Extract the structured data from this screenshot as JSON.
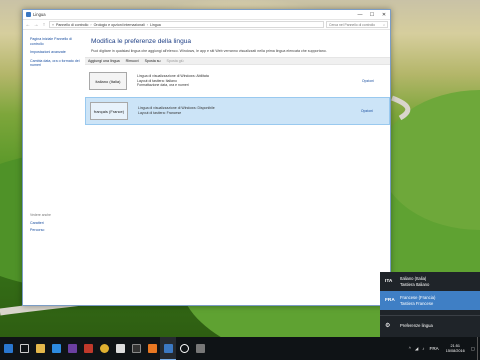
{
  "window": {
    "title": "Lingua",
    "minimize": "—",
    "maximize": "☐",
    "close": "✕",
    "back": "←",
    "forward": "→",
    "up": "↑",
    "breadcrumb": [
      "Pannello di controllo",
      "Orologio e opzioni internazionali",
      "Lingua"
    ],
    "search_placeholder": "Cerca nel Pannello di controllo",
    "search_icon": "⌕"
  },
  "leftnav": {
    "links": [
      "Pagina iniziale Pannello di controllo",
      "Impostazioni avanzate",
      "Cambia data, ora o formato dei numeri"
    ],
    "see_also": "Vedere anche",
    "bottom_links": [
      "Caratteri",
      "Percorso"
    ]
  },
  "main": {
    "heading": "Modifica le preferenze della lingua",
    "description": "Puoi digitare in qualsiasi lingua che aggiungi all'elenco. Windows, le app e siti Web verranno visualizzati nella prima lingua elencata che supportano.",
    "toolbar": [
      "Aggiungi una lingua",
      "Rimuovi",
      "Sposta su",
      "Sposta giù"
    ],
    "languages": [
      {
        "name": "italiano (Italia)",
        "lines": [
          "Lingua di visualizzazione di Windows: Abilitata",
          "Layout di tastiera: Italiano",
          "Formattazione data, ora e numeri"
        ],
        "options": "Opzioni"
      },
      {
        "name": "français (France)",
        "lines": [
          "Lingua di visualizzazione di Windows: Disponibile",
          "Layout di tastiera: Francese"
        ],
        "options": "Opzioni"
      }
    ]
  },
  "flyout": {
    "items": [
      {
        "code": "ITA",
        "line1": "Italiano (Italia)",
        "line2": "Tastiera Italiano"
      },
      {
        "code": "FRA",
        "line1": "Francese (Francia)",
        "line2": "Tastiera Francese"
      }
    ],
    "preferences": "Preferenze lingua",
    "gear_icon": "⚙"
  },
  "taskbar": {
    "lang": "FRA",
    "time": "21:51",
    "date": "15/08/2016",
    "tray_up": "^",
    "notify": "▢"
  },
  "colors": {
    "selection": "#cce4f7",
    "flyout_bg": "#1f2429",
    "flyout_selected": "#3f7fc5",
    "link": "#1a4fa0"
  }
}
